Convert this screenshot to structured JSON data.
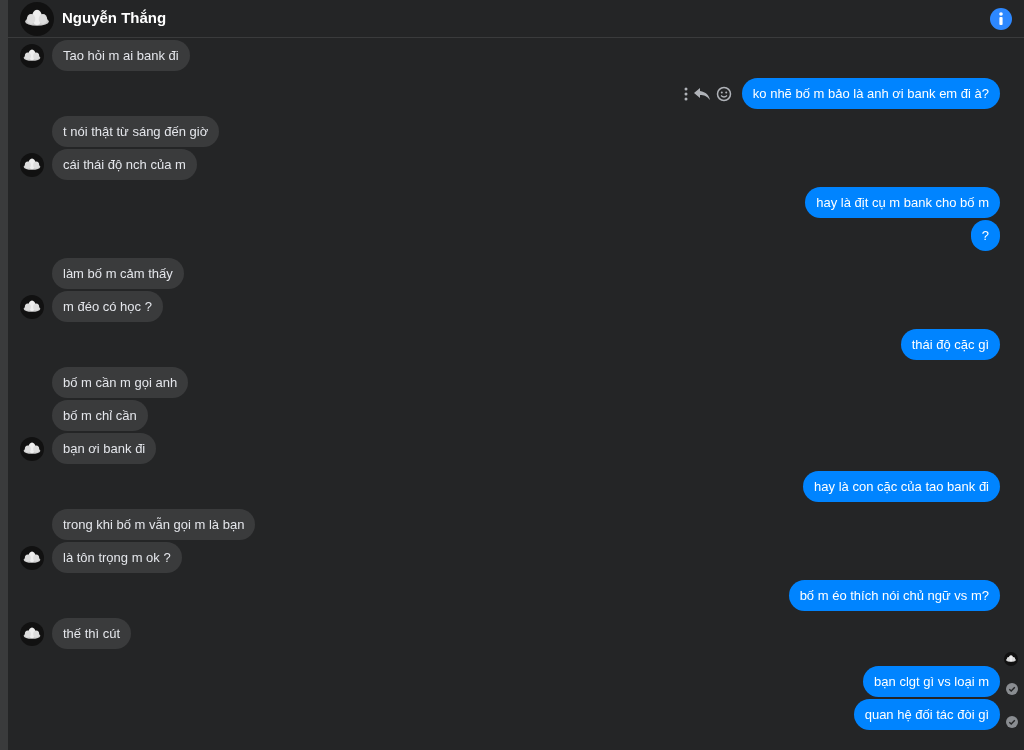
{
  "header": {
    "contact_name": "Nguyễn Thắng"
  },
  "timeline": [
    {
      "kind": "incoming",
      "messages": [
        {
          "text": "Tao hỏi m ai bank đi"
        }
      ]
    },
    {
      "kind": "outgoing",
      "messages": [
        {
          "text": "ko nhẽ bố m bảo là anh ơi bank em đi à?",
          "hovered": true,
          "delivered": false
        }
      ]
    },
    {
      "kind": "incoming",
      "messages": [
        {
          "text": "t nói thật từ sáng đến giờ"
        },
        {
          "text": "cái thái độ nch của m"
        }
      ]
    },
    {
      "kind": "outgoing",
      "messages": [
        {
          "text": "hay là địt cụ m bank cho bố m",
          "hovered": false,
          "delivered": false
        },
        {
          "text": "?",
          "hovered": false,
          "delivered": false
        }
      ]
    },
    {
      "kind": "incoming",
      "messages": [
        {
          "text": "làm bố m cảm thấy"
        },
        {
          "text": "m đéo có học ?"
        }
      ]
    },
    {
      "kind": "outgoing",
      "messages": [
        {
          "text": "thái độ cặc gì",
          "hovered": false,
          "delivered": false
        }
      ]
    },
    {
      "kind": "incoming",
      "messages": [
        {
          "text": "bố m cần m gọi anh"
        },
        {
          "text": "bố m chỉ cần"
        },
        {
          "text": "bạn ơi bank đi"
        }
      ]
    },
    {
      "kind": "outgoing",
      "messages": [
        {
          "text": "hay là con cặc của tao bank đi",
          "hovered": false,
          "delivered": false
        }
      ]
    },
    {
      "kind": "incoming",
      "messages": [
        {
          "text": "trong khi bố m vẫn gọi m là bạn"
        },
        {
          "text": "là tôn trọng m ok ?"
        }
      ]
    },
    {
      "kind": "outgoing",
      "messages": [
        {
          "text": "bố m éo thích nói chủ ngữ vs m?",
          "hovered": false,
          "delivered": false
        }
      ]
    },
    {
      "kind": "incoming",
      "messages": [
        {
          "text": "thế thì cút"
        }
      ]
    },
    {
      "kind": "seen_marker"
    },
    {
      "kind": "outgoing",
      "messages": [
        {
          "text": "bạn clgt gì vs loại m",
          "hovered": false,
          "delivered": true
        },
        {
          "text": "quan hệ đối tác đòi gì",
          "hovered": false,
          "delivered": true
        }
      ]
    }
  ]
}
